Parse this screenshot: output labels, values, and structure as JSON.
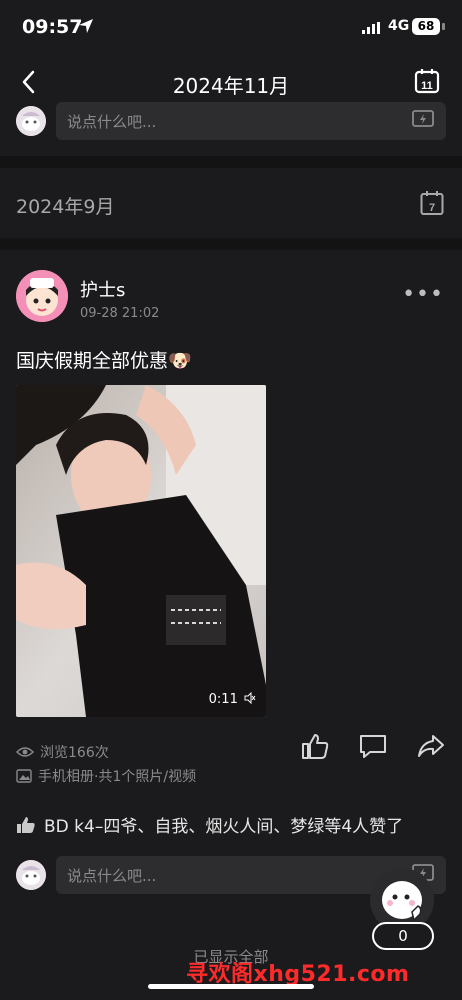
{
  "status": {
    "time": "09:57",
    "network": "4G",
    "battery": "68"
  },
  "nav": {
    "title": "2024年11月"
  },
  "comment_placeholder": "说点什么吧...",
  "section_month": "2024年9月",
  "calendar_day_nav": "11",
  "calendar_day_section": "7",
  "post": {
    "author": "护士s",
    "time": "09-28 21:02",
    "text": "国庆假期全部优惠🐶",
    "video_duration": "0:11",
    "views": "浏览166次",
    "source": "手机相册·共1个照片/视频",
    "likes": "BD  k4–四爷、自我、烟火人间、梦绿等4人赞了"
  },
  "float_count": "0",
  "show_all": "已显示全部",
  "watermark": "寻欢阁xhg521.com"
}
